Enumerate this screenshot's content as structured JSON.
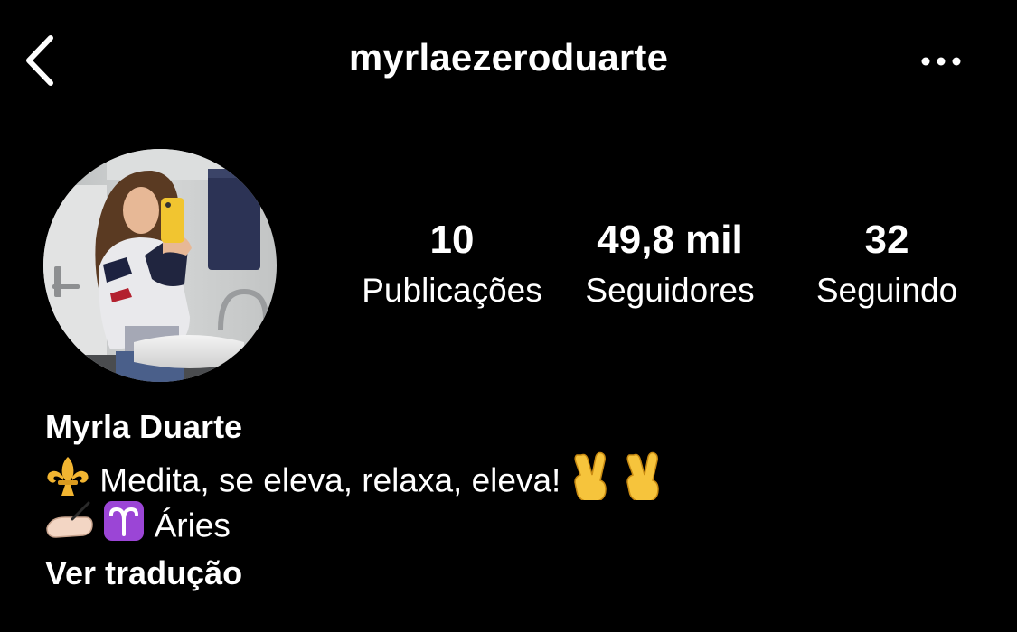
{
  "header": {
    "username": "myrlaezeroduarte",
    "back_icon": "chevron-left-icon",
    "more_icon": "more-horizontal-icon"
  },
  "stats": {
    "posts": {
      "value": "10",
      "label": "Publicações"
    },
    "followers": {
      "value": "49,8 mil",
      "label": "Seguidores"
    },
    "following": {
      "value": "32",
      "label": "Seguindo"
    }
  },
  "profile": {
    "full_name": "Myrla Duarte",
    "bio_line_1": "Medita, se eleva, relaxa, eleva!",
    "bio_line_2": "Áries",
    "bio_emojis": [
      "fleur-de-lis",
      "victory-hand",
      "victory-hand",
      "writing-hand",
      "aries-sign"
    ],
    "translate_label": "Ver tradução"
  },
  "colors": {
    "background": "#000000",
    "text": "#ffffff",
    "emoji_gold": "#f2b531",
    "aries_purple": "#9b45d6"
  }
}
